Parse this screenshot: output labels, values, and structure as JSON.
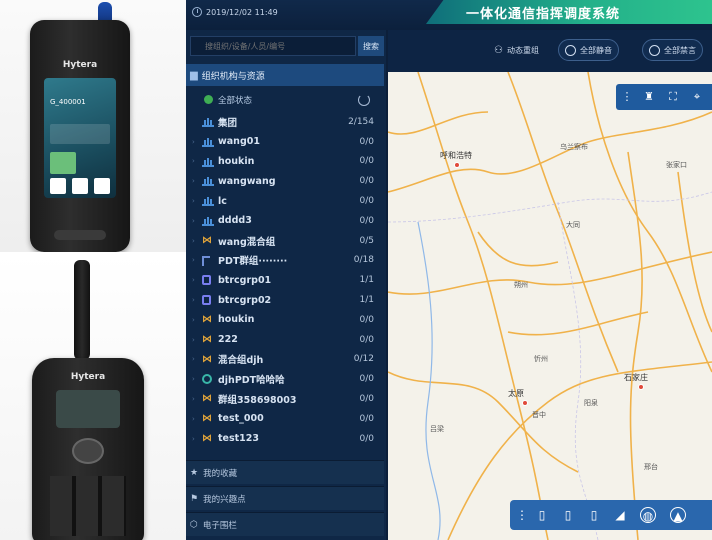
{
  "header": {
    "datetime": "2019/12/02  11:49",
    "title": "一体化通信指挥调度系统"
  },
  "photos": {
    "device1_brand": "Hytera",
    "device1_screen_id": "G_400001",
    "device2_brand": "Hytera"
  },
  "search": {
    "placeholder": "搜组织/设备/人员/编号",
    "button": "搜索"
  },
  "panel": {
    "section_title": "组织机构与资源",
    "status_label": "全部状态"
  },
  "tree": [
    {
      "name": "集团",
      "count": "2/154",
      "icon": "org-icon"
    },
    {
      "name": "wang01",
      "count": "0/0",
      "icon": "org-icon"
    },
    {
      "name": "houkin",
      "count": "0/0",
      "icon": "org-icon"
    },
    {
      "name": "wangwang",
      "count": "0/0",
      "icon": "org-icon"
    },
    {
      "name": "lc",
      "count": "0/0",
      "icon": "org-icon"
    },
    {
      "name": "dddd3",
      "count": "0/0",
      "icon": "org-icon"
    },
    {
      "name": "wang混合组",
      "count": "0/5",
      "icon": "mixed-group-icon"
    },
    {
      "name": "PDT群组········",
      "count": "0/18",
      "icon": "pdt-group-icon"
    },
    {
      "name": "btrcgrp01",
      "count": "1/1",
      "icon": "trc-group-icon"
    },
    {
      "name": "btrcgrp02",
      "count": "1/1",
      "icon": "trc-group-icon"
    },
    {
      "name": "houkin",
      "count": "0/0",
      "icon": "mixed-group-icon"
    },
    {
      "name": "222",
      "count": "0/0",
      "icon": "mixed-group-icon"
    },
    {
      "name": "混合组djh",
      "count": "0/12",
      "icon": "mixed-group-icon"
    },
    {
      "name": "djhPDT哈哈哈",
      "count": "0/0",
      "icon": "djh-group-icon"
    },
    {
      "name": "群组358698003",
      "count": "0/0",
      "icon": "mixed-group-icon"
    },
    {
      "name": "test_000",
      "count": "0/0",
      "icon": "mixed-group-icon"
    },
    {
      "name": "test123",
      "count": "0/0",
      "icon": "mixed-group-icon"
    }
  ],
  "nav": {
    "favorites": "我的收藏",
    "poi": "我的兴趣点",
    "fence": "电子围栏"
  },
  "map_toolbar": {
    "dynamic": "动态重组",
    "mute_all": "全部静音",
    "forbid_all": "全部禁言"
  },
  "map": {
    "cities": [
      "呼和浩特",
      "石家庄",
      "太原"
    ],
    "towns": [
      "乌兰察布",
      "张家口",
      "大同",
      "朔州",
      "忻州",
      "阳泉",
      "晋中",
      "吕梁",
      "邢台"
    ]
  },
  "colors": {
    "app_bg": "#0c1f3a",
    "panel_bg": "#0f2746",
    "accent": "#1d4a7e",
    "title_banner": "#23b08a",
    "map_bg": "#f4f2ea",
    "road": "#f0b24a"
  }
}
